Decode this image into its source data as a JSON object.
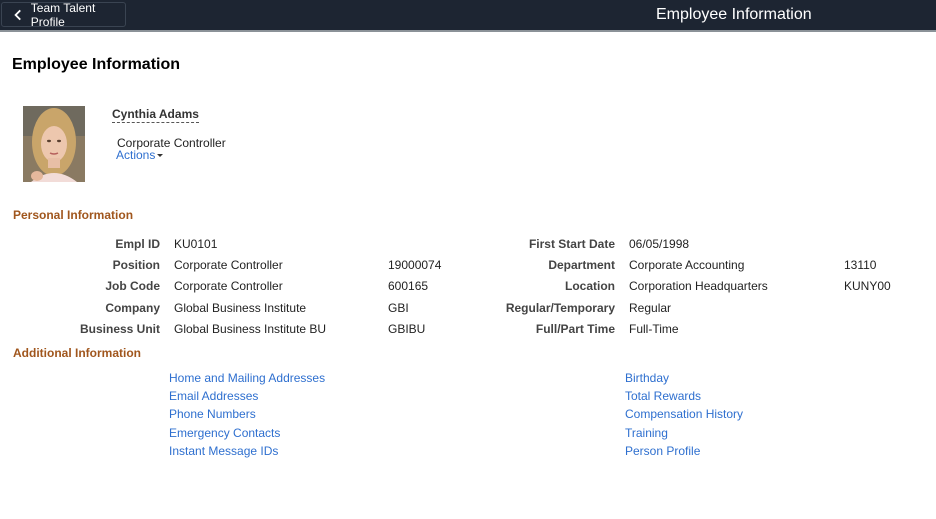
{
  "header": {
    "back_label": "Team Talent Profile",
    "title": "Employee Information"
  },
  "page": {
    "title": "Employee Information"
  },
  "employee": {
    "name": "Cynthia Adams",
    "job_title": "Corporate Controller",
    "actions_label": "Actions"
  },
  "personal": {
    "title": "Personal Information",
    "left": [
      {
        "label": "Empl ID",
        "value": "KU0101",
        "code": ""
      },
      {
        "label": "Position",
        "value": "Corporate Controller",
        "code": "19000074"
      },
      {
        "label": "Job Code",
        "value": "Corporate Controller",
        "code": "600165"
      },
      {
        "label": "Company",
        "value": "Global Business Institute",
        "code": "GBI"
      },
      {
        "label": "Business Unit",
        "value": "Global Business Institute BU",
        "code": "GBIBU"
      }
    ],
    "right": [
      {
        "label": "First Start Date",
        "value": "06/05/1998",
        "code": ""
      },
      {
        "label": "Department",
        "value": "Corporate Accounting",
        "code": "13110"
      },
      {
        "label": "Location",
        "value": "Corporation Headquarters",
        "code": "KUNY00"
      },
      {
        "label": "Regular/Temporary",
        "value": "Regular",
        "code": ""
      },
      {
        "label": "Full/Part Time",
        "value": "Full-Time",
        "code": ""
      }
    ]
  },
  "additional": {
    "title": "Additional Information",
    "left_links": [
      "Home and Mailing Addresses",
      "Email Addresses",
      "Phone Numbers",
      "Emergency Contacts",
      "Instant Message IDs"
    ],
    "right_links": [
      "Birthday",
      "Total Rewards",
      "Compensation History",
      "Training",
      "Person Profile"
    ]
  },
  "colors": {
    "header_bg": "#1d2532",
    "section_title": "#a0561d",
    "link": "#2e6fcf"
  }
}
